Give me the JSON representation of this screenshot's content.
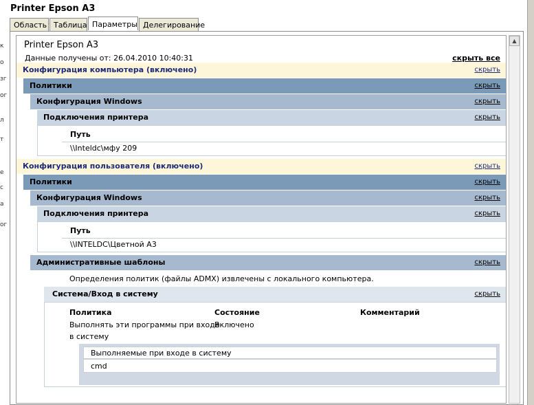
{
  "window": {
    "title": "Printer Epson A3"
  },
  "tabs": [
    "Область",
    "Таблица",
    "Параметры",
    "Делегирование"
  ],
  "report": {
    "title": "Printer Epson A3",
    "received": "Данные получены от: 26.04.2010 10:40:31",
    "hide_all": "скрыть все",
    "hide": "скрыть",
    "computer": {
      "header": "Конфигурация компьютера (включено)",
      "policies": "Политики",
      "windows": "Конфигурация Windows",
      "printers": "Подключения принтера",
      "path_label": "Путь",
      "path_value": "\\\\Inteldc\\мфу 209"
    },
    "user": {
      "header": "Конфигурация пользователя (включено)",
      "policies": "Политики",
      "windows": "Конфигурация Windows",
      "printers": "Подключения принтера",
      "path_label": "Путь",
      "path_value": "\\\\INTELDC\\Цветной А3",
      "admin_templates": "Административные шаблоны",
      "admx_note": "Определения политик (файлы ADMX) извлечены с локального компьютера.",
      "system_logon": "Система/Вход в систему",
      "table": {
        "col_policy": "Политика",
        "col_state": "Состояние",
        "col_comment": "Комментарий",
        "policy_line1": "Выполнять эти программы при входе",
        "policy_line2": "в систему",
        "state": "Включено",
        "sub_header": "Выполняемые при входе в систему",
        "sub_value": "cmd"
      }
    }
  }
}
